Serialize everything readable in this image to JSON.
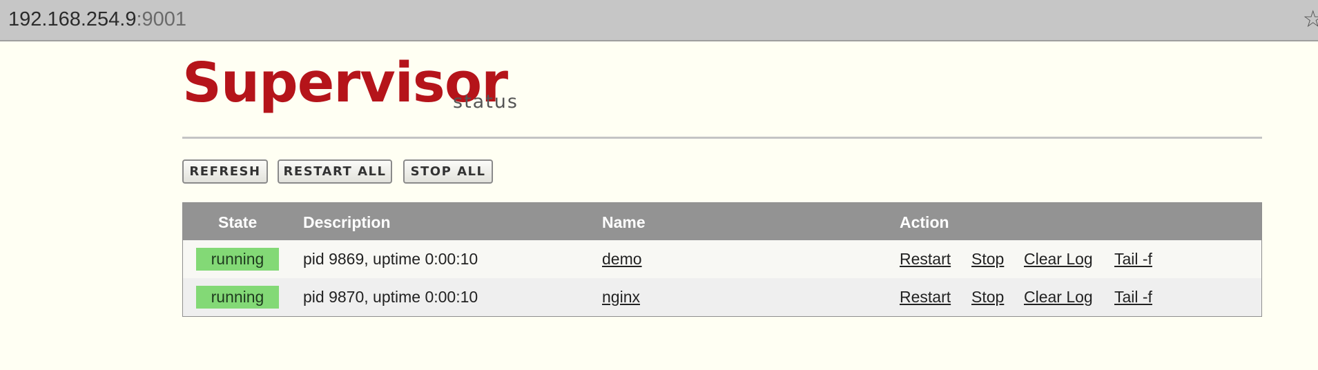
{
  "browser": {
    "url_host": "192.168.254.9",
    "url_port": ":9001",
    "bookmark_icon": "star-icon"
  },
  "header": {
    "logo_text": "Supervisor",
    "logo_subtitle": "status"
  },
  "toolbar": {
    "refresh_label": "REFRESH",
    "restart_all_label": "RESTART ALL",
    "stop_all_label": "STOP ALL"
  },
  "table": {
    "columns": [
      "State",
      "Description",
      "Name",
      "Action"
    ],
    "rows": [
      {
        "state": "running",
        "description": "pid 9869, uptime 0:00:10",
        "name": "demo",
        "actions": [
          "Restart",
          "Stop",
          "Clear Log",
          "Tail -f"
        ]
      },
      {
        "state": "running",
        "description": "pid 9870, uptime 0:00:10",
        "name": "nginx",
        "actions": [
          "Restart",
          "Stop",
          "Clear Log",
          "Tail -f"
        ]
      }
    ]
  },
  "colors": {
    "page_background": "#fffff3",
    "logo_red": "#b5141a",
    "header_gray": "#939393",
    "running_green": "#83d976"
  }
}
